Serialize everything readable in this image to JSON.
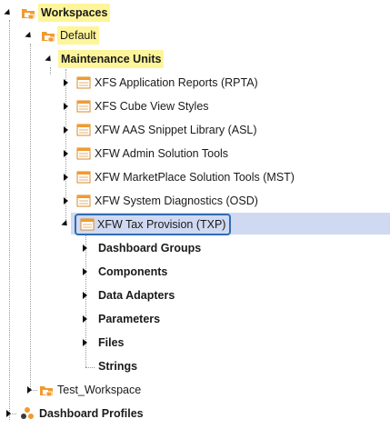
{
  "tree": {
    "root": {
      "label": "Workspaces",
      "icon": "workspaces-folder-icon",
      "expanded": true
    },
    "default_ws": {
      "label": "Default",
      "icon": "workspace-folder-icon",
      "expanded": true
    },
    "maint_units": {
      "label": "Maintenance Units",
      "expanded": true
    },
    "units": [
      {
        "label": "XFS Application Reports (RPTA)",
        "icon": "maintenance-unit-icon"
      },
      {
        "label": "XFS Cube View Styles",
        "icon": "maintenance-unit-icon"
      },
      {
        "label": "XFW AAS Snippet Library (ASL)",
        "icon": "maintenance-unit-icon"
      },
      {
        "label": "XFW Admin Solution Tools",
        "icon": "maintenance-unit-icon"
      },
      {
        "label": "XFW MarketPlace Solution Tools (MST)",
        "icon": "maintenance-unit-icon"
      },
      {
        "label": "XFW System Diagnostics (OSD)",
        "icon": "maintenance-unit-icon"
      },
      {
        "label": "XFW Tax Provision (TXP)",
        "icon": "maintenance-unit-icon",
        "selected": true
      }
    ],
    "txp_children": [
      {
        "label": "Dashboard Groups"
      },
      {
        "label": "Components"
      },
      {
        "label": "Data Adapters"
      },
      {
        "label": "Parameters"
      },
      {
        "label": "Files"
      },
      {
        "label": "Strings"
      }
    ],
    "test_ws": {
      "label": "Test_Workspace",
      "icon": "workspace-folder-icon"
    },
    "dash_profiles": {
      "label": "Dashboard Profiles",
      "icon": "dashboard-profiles-icon"
    }
  },
  "colors": {
    "highlight_yellow": "#fdf59a",
    "selection_fill": "#cfd9f2",
    "selection_border": "#2f6db5",
    "folder_orange": "#f29a2e"
  }
}
